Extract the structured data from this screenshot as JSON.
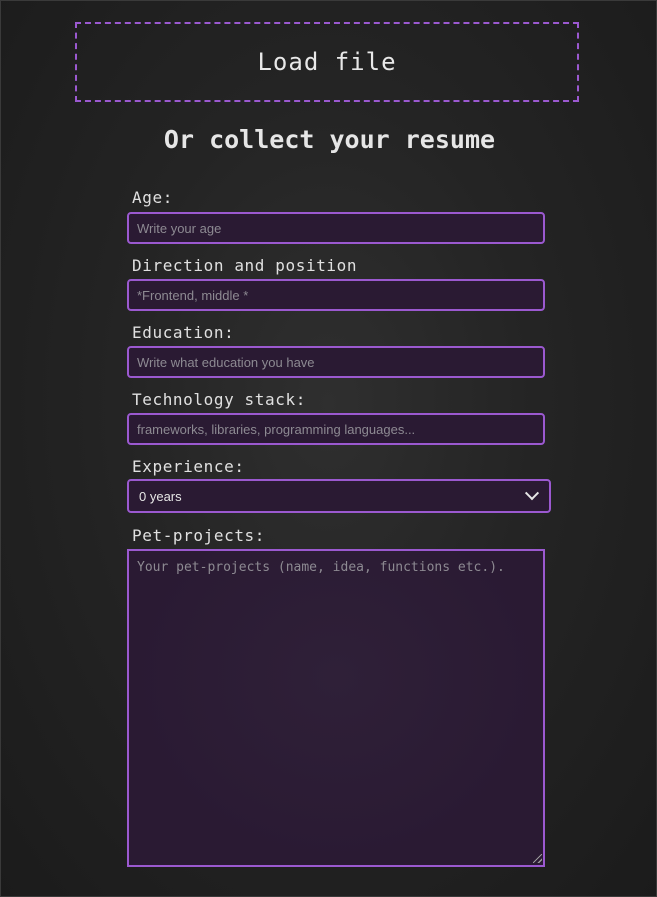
{
  "load_file": {
    "label": "Load file"
  },
  "heading": "Or collect your resume",
  "form": {
    "age": {
      "label": "Age:",
      "placeholder": "Write your age",
      "value": ""
    },
    "direction": {
      "label": "Direction and position",
      "placeholder": "*Frontend, middle *",
      "value": ""
    },
    "education": {
      "label": "Education:",
      "placeholder": "Write what education you have",
      "value": ""
    },
    "tech_stack": {
      "label": "Technology stack:",
      "placeholder": "frameworks, libraries, programming languages...",
      "value": ""
    },
    "experience": {
      "label": "Experience:",
      "selected": "0 years"
    },
    "pet_projects": {
      "label": "Pet-projects:",
      "placeholder": "Your pet-projects (name, idea, functions etc.).",
      "value": ""
    }
  },
  "colors": {
    "accent": "#9b59d0",
    "field_background": "#2a1a33",
    "page_background": "#242424"
  }
}
